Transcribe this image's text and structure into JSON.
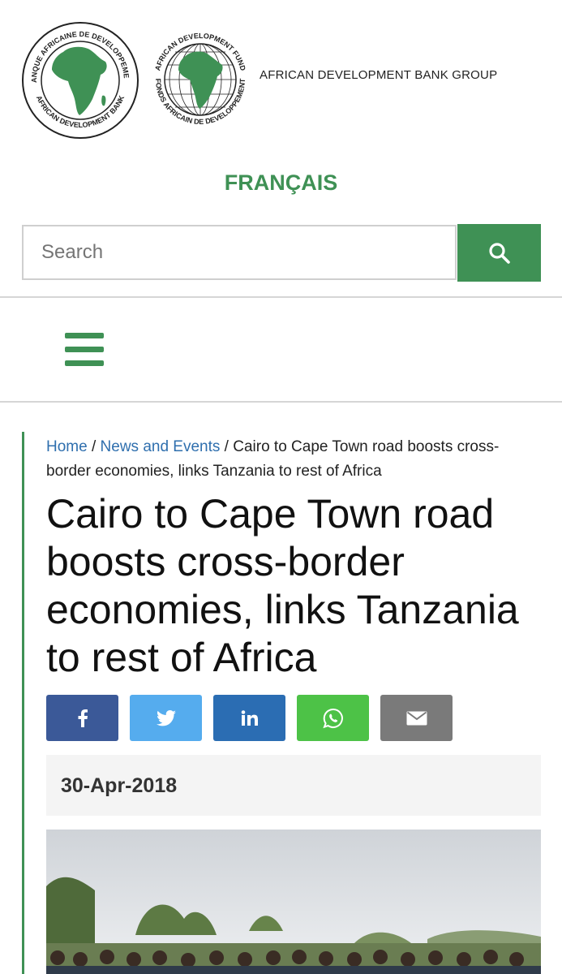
{
  "header": {
    "logo_adb_text_top": "BANQUE AFRICAINE DE DEVELOPPEMENT",
    "logo_adb_text_bottom": "AFRICAN DEVELOPMENT BANK",
    "logo_adf_text_top": "AFRICAN DEVELOPMENT FUND",
    "logo_adf_text_bottom": "FONDS AFRICAIN DE DEVELOPPEMENT",
    "group_name": "AFRICAN DEVELOPMENT BANK GROUP",
    "language_link": "FRANÇAIS"
  },
  "search": {
    "placeholder": "Search"
  },
  "breadcrumb": {
    "home": "Home",
    "sep1": " / ",
    "news": "News and Events",
    "sep2": " / ",
    "current": "Cairo to Cape Town road boosts cross-border economies, links Tanzania to rest of Africa"
  },
  "article": {
    "title": "Cairo to Cape Town road boosts cross-border economies, links Tanzania to rest of Africa",
    "date": "30-Apr-2018"
  },
  "share": [
    {
      "name": "facebook",
      "icon": "facebook-icon",
      "color": "#3b5998"
    },
    {
      "name": "twitter",
      "icon": "twitter-icon",
      "color": "#55acee"
    },
    {
      "name": "linkedin",
      "icon": "linkedin-icon",
      "color": "#2b6db3"
    },
    {
      "name": "whatsapp",
      "icon": "whatsapp-icon",
      "color": "#4dc247"
    },
    {
      "name": "email",
      "icon": "email-icon",
      "color": "#7a7a7a"
    }
  ],
  "colors": {
    "brand_green": "#3f9155",
    "link_blue": "#2f6fae"
  }
}
